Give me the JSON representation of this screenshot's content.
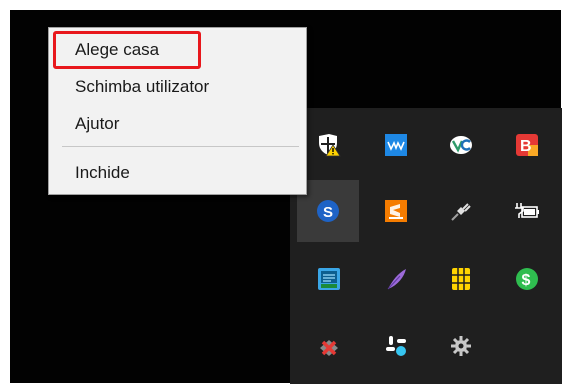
{
  "context_menu": {
    "items": [
      {
        "label": "Alege casa"
      },
      {
        "label": "Schimba utilizator"
      },
      {
        "label": "Ajutor"
      },
      {
        "label": "Inchide"
      }
    ]
  },
  "highlight_color": "#e8171c",
  "tray": {
    "icons": [
      {
        "name": "security-shield-warning-icon",
        "color": "#ffd200"
      },
      {
        "name": "waves-app-icon",
        "color": "#1e88e5"
      },
      {
        "name": "vc-app-icon",
        "color": "#2e9a6a"
      },
      {
        "name": "b-app-icon",
        "color": "#e53935"
      },
      {
        "name": "s-dollar-icon",
        "color": "#1e63c6"
      },
      {
        "name": "sublime-app-icon",
        "color": "#f57c00"
      },
      {
        "name": "power-plug-icon",
        "color": "#bdbdbd"
      },
      {
        "name": "battery-charging-icon",
        "color": "#ffffff"
      },
      {
        "name": "network-manager-icon",
        "color": "#3aa6e6"
      },
      {
        "name": "feather-icon",
        "color": "#9c6ad9"
      },
      {
        "name": "sim-card-icon",
        "color": "#ffd400"
      },
      {
        "name": "dollar-circle-icon",
        "color": "#2fbd4f"
      },
      {
        "name": "disconnected-x-icon",
        "color": "#e53935"
      },
      {
        "name": "slack-icon",
        "color": "#36c5f0"
      },
      {
        "name": "gear-icon",
        "color": "#c8c8c8"
      }
    ]
  }
}
